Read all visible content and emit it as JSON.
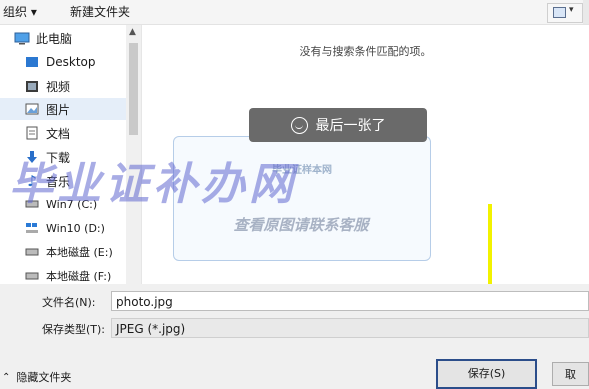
{
  "toolbar": {
    "organize": "组织 ▾",
    "new_folder": "新建文件夹"
  },
  "nav": {
    "items": [
      {
        "label": "此电脑",
        "icon": "computer-icon"
      },
      {
        "label": "Desktop",
        "icon": "desktop-folder-icon"
      },
      {
        "label": "视频",
        "icon": "video-folder-icon"
      },
      {
        "label": "图片",
        "icon": "pictures-folder-icon"
      },
      {
        "label": "文档",
        "icon": "documents-folder-icon"
      },
      {
        "label": "下载",
        "icon": "download-arrow-icon"
      },
      {
        "label": "音乐",
        "icon": "music-note-icon"
      },
      {
        "label": "Win7 (C:)",
        "icon": "drive-icon"
      },
      {
        "label": "Win10 (D:)",
        "icon": "windows-drive-icon"
      },
      {
        "label": "本地磁盘 (E:)",
        "icon": "drive-icon"
      },
      {
        "label": "本地磁盘 (F:)",
        "icon": "drive-icon"
      }
    ],
    "selected": "图片"
  },
  "content": {
    "empty_message": "没有与搜索条件匹配的项。",
    "toast": "最后一张了",
    "watermark_small": "毕业证样本网",
    "watermark_big": "毕业证补办网",
    "watermark_sub": "查看原图请联系客服"
  },
  "form": {
    "filename_label": "文件名(N):",
    "filename_value": "photo.jpg",
    "filetype_label": "保存类型(T):",
    "filetype_value": "JPEG (*.jpg)"
  },
  "footer": {
    "hide_folders": "隐藏文件夹",
    "save": "保存(S)",
    "cancel": "取"
  },
  "colors": {
    "selected_bg": "#e5eef9",
    "save_border": "#2b4d8a",
    "arrow": "#f2f200"
  }
}
